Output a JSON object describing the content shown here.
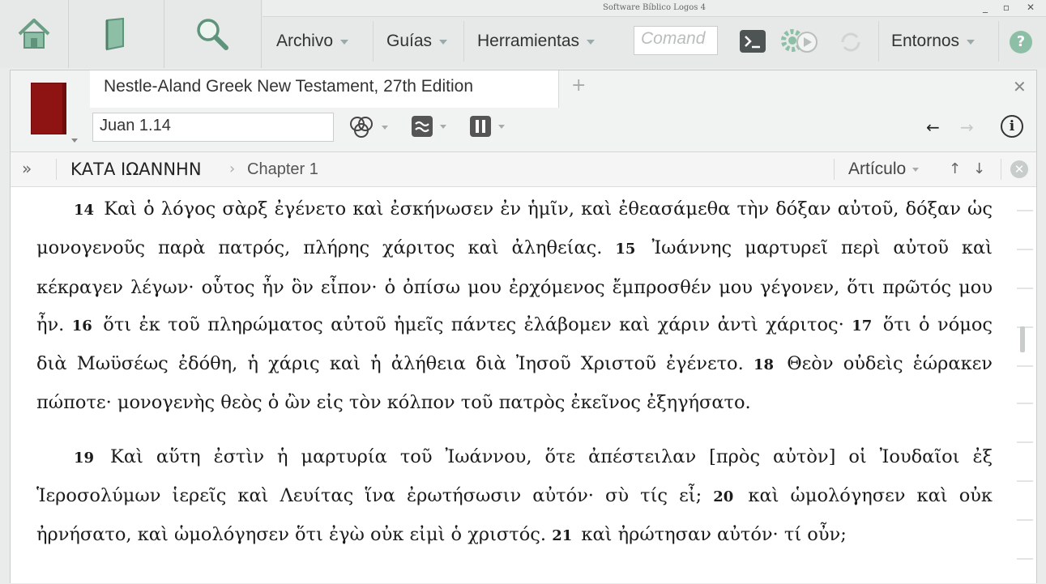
{
  "window": {
    "title": "Software Bíblico Logos 4",
    "controls": [
      "_",
      "▫",
      "✕"
    ]
  },
  "toolbar": {
    "home_icon": "home-icon",
    "library_icon": "library-book-icon",
    "search_icon": "search-icon",
    "menus": [
      "Archivo",
      "Guías",
      "Herramientas"
    ],
    "command_placeholder": "Comand",
    "environments": "Entornos",
    "help": "?"
  },
  "panel": {
    "tab_title": "Nestle-Aland Greek New Testament, 27th Edition",
    "add_tab": "+",
    "close_tab": "✕",
    "reference": "Juan 1.14",
    "breadcrumb": {
      "expand": "»",
      "book": "ΚΑΤΑ ΙΩΑΝΝΗΝ",
      "separator": "›",
      "chapter": "Chapter 1"
    },
    "navigation": {
      "type": "Artículo",
      "up": "↑",
      "down": "↓"
    },
    "info": "i",
    "back": "←",
    "forward": "→"
  },
  "text": {
    "p1": [
      {
        "n": "14",
        "t": "Καὶ ὁ λόγος σὰρξ ἐγένετο καὶ ἐσκήνωσεν ἐν ἡμῖν, καὶ ἐθεασάμεθα τὴν δόξαν αὐτοῦ, δόξαν ὡς μονογενοῦς παρὰ πατρός, πλήρης χάριτος καὶ ἀληθείας."
      },
      {
        "n": "15",
        "t": "Ἰωάννης μαρτυρεῖ περὶ αὐτοῦ καὶ κέκραγεν λέγων· οὗτος ἦν ὃν εἶπον· ὁ ὀπίσω μου ἐρχόμενος ἔμπροσθέν μου γέγονεν, ὅτι πρῶτός μου ἦν."
      },
      {
        "n": "16",
        "t": "ὅτι ἐκ τοῦ πληρώματος αὐτοῦ ἡμεῖς πάντες ἐλάβομεν καὶ χάριν ἀντὶ χάριτος·"
      },
      {
        "n": "17",
        "t": "ὅτι ὁ νόμος διὰ Μωϋσέως ἐδόθη, ἡ χάρις καὶ ἡ ἀλήθεια διὰ Ἰησοῦ Χριστοῦ ἐγένετο."
      },
      {
        "n": "18",
        "t": "Θεὸν οὐδεὶς ἑώρακεν πώποτε· μονογενὴς θεὸς ὁ ὢν εἰς τὸν κόλπον τοῦ πατρὸς ἐκεῖνος ἐξηγήσατο."
      }
    ],
    "p2": [
      {
        "n": "19",
        "t": "Καὶ αὕτη ἐστὶν ἡ μαρτυρία τοῦ Ἰωάννου, ὅτε ἀπέστειλαν [πρὸς αὐτὸν] οἱ Ἰουδαῖοι ἐξ Ἱεροσολύμων ἱερεῖς καὶ Λευίτας ἵνα ἐρωτήσωσιν αὐτόν· σὺ τίς εἶ;"
      },
      {
        "n": "20",
        "t": "καὶ ὡμολόγησεν καὶ οὐκ ἠρνήσατο, καὶ ὡμολόγησεν ὅτι ἐγὼ οὐκ εἰμὶ ὁ χριστός."
      },
      {
        "n": "21",
        "t": "καὶ ἠρώτησαν αὐτόν· τί οὖν;"
      }
    ]
  }
}
